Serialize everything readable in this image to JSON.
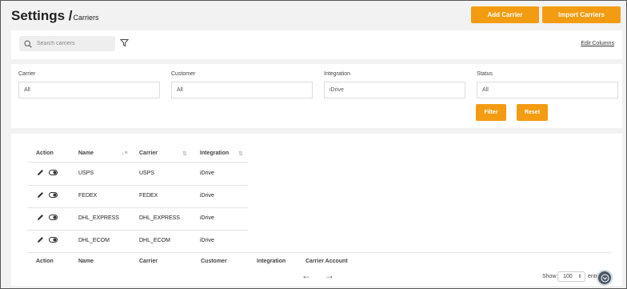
{
  "header": {
    "title": "Settings /",
    "breadcrumb": "Carriers",
    "add_carrier_label": "Add Carrier",
    "import_carriers_label": "Import Carriers"
  },
  "search": {
    "placeholder": "Search carriers",
    "edit_columns_label": "Edit Columns"
  },
  "filters": {
    "carrier": {
      "label": "Carrier",
      "value": "All"
    },
    "customer": {
      "label": "Customer",
      "value": "All"
    },
    "integration": {
      "label": "Integration",
      "value": "iDrive"
    },
    "status": {
      "label": "Status",
      "value": "All"
    },
    "filter_button": "Filter",
    "reset_button": "Reset"
  },
  "table": {
    "headers": [
      "Action",
      "Name",
      "Carrier",
      "Integration"
    ],
    "footer_headers": [
      "Action",
      "Name",
      "Carrier",
      "Customer",
      "Integration",
      "Carrier Account"
    ],
    "rows": [
      {
        "name": "USPS",
        "carrier": "USPS",
        "integration": "iDrive"
      },
      {
        "name": "FEDEX",
        "carrier": "FEDEX",
        "integration": "iDrive"
      },
      {
        "name": "DHL_EXPRESS",
        "carrier": "DHL_EXPRESS",
        "integration": "iDrive"
      },
      {
        "name": "DHL_ECOM",
        "carrier": "DHL_ECOM",
        "integration": "iDrive"
      }
    ]
  },
  "pagination": {
    "show_label": "Show",
    "page_size": "100",
    "entries_label": "entries"
  },
  "colors": {
    "accent": "#f39c12",
    "background": "#f2f2f2"
  }
}
